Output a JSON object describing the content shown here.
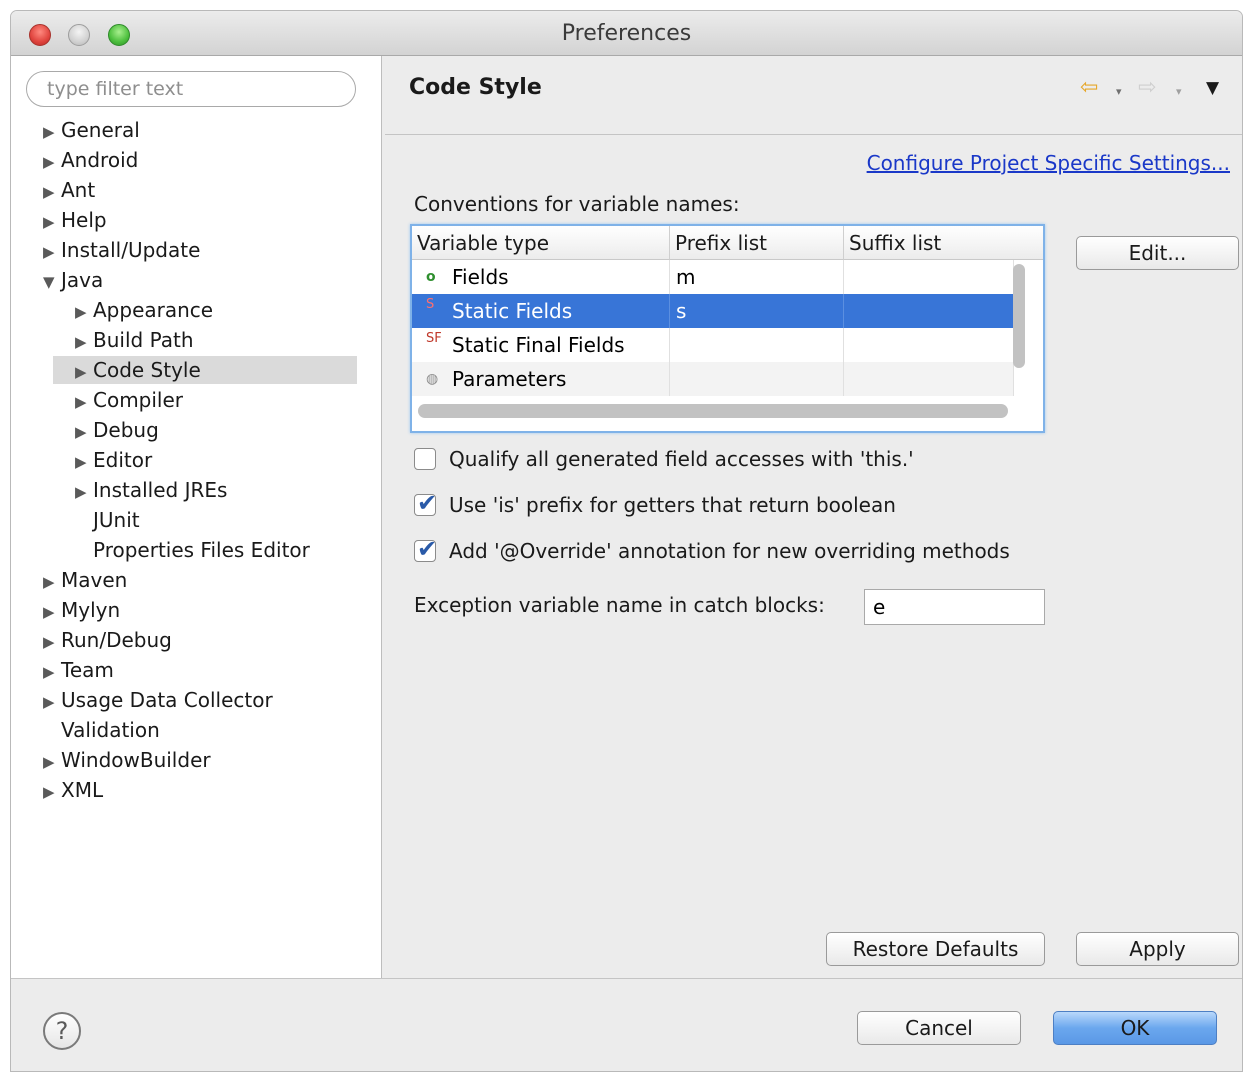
{
  "window": {
    "title": "Preferences"
  },
  "filter": {
    "placeholder": "type filter text"
  },
  "tree": [
    {
      "label": "General",
      "level": 0,
      "arrow": "▶"
    },
    {
      "label": "Android",
      "level": 0,
      "arrow": "▶"
    },
    {
      "label": "Ant",
      "level": 0,
      "arrow": "▶"
    },
    {
      "label": "Help",
      "level": 0,
      "arrow": "▶"
    },
    {
      "label": "Install/Update",
      "level": 0,
      "arrow": "▶"
    },
    {
      "label": "Java",
      "level": 0,
      "arrow": "▼"
    },
    {
      "label": "Appearance",
      "level": 1,
      "arrow": "▶"
    },
    {
      "label": "Build Path",
      "level": 1,
      "arrow": "▶"
    },
    {
      "label": "Code Style",
      "level": 1,
      "arrow": "▶",
      "selected": true
    },
    {
      "label": "Compiler",
      "level": 1,
      "arrow": "▶"
    },
    {
      "label": "Debug",
      "level": 1,
      "arrow": "▶"
    },
    {
      "label": "Editor",
      "level": 1,
      "arrow": "▶"
    },
    {
      "label": "Installed JREs",
      "level": 1,
      "arrow": "▶"
    },
    {
      "label": "JUnit",
      "level": 1,
      "arrow": ""
    },
    {
      "label": "Properties Files Editor",
      "level": 1,
      "arrow": ""
    },
    {
      "label": "Maven",
      "level": 0,
      "arrow": "▶"
    },
    {
      "label": "Mylyn",
      "level": 0,
      "arrow": "▶"
    },
    {
      "label": "Run/Debug",
      "level": 0,
      "arrow": "▶"
    },
    {
      "label": "Team",
      "level": 0,
      "arrow": "▶"
    },
    {
      "label": "Usage Data Collector",
      "level": 0,
      "arrow": "▶"
    },
    {
      "label": "Validation",
      "level": 0,
      "arrow": ""
    },
    {
      "label": "WindowBuilder",
      "level": 0,
      "arrow": "▶"
    },
    {
      "label": "XML",
      "level": 0,
      "arrow": "▶"
    }
  ],
  "page": {
    "title": "Code Style",
    "nav": {
      "back": "⇦",
      "forward": "⇨",
      "dropdown": "▾",
      "menu": "▼"
    },
    "project_link": "Configure Project Specific Settings...",
    "conventions_label": "Conventions for variable names:",
    "table": {
      "headers": [
        "Variable type",
        "Prefix list",
        "Suffix list"
      ],
      "rows": [
        {
          "icon": "field-icon",
          "glyph": "o",
          "type": "Fields",
          "prefix": "m",
          "suffix": ""
        },
        {
          "icon": "static-field-icon",
          "glyph": "S",
          "type": "Static Fields",
          "prefix": "s",
          "suffix": "",
          "selected": true
        },
        {
          "icon": "static-final-field-icon",
          "glyph": "SF",
          "type": "Static Final Fields",
          "prefix": "",
          "suffix": ""
        },
        {
          "icon": "parameter-icon",
          "glyph": "◍",
          "type": "Parameters",
          "prefix": "",
          "suffix": ""
        }
      ]
    },
    "edit_button": "Edit...",
    "checkboxes": [
      {
        "label": "Qualify all generated field accesses with 'this.'",
        "checked": false
      },
      {
        "label": "Use 'is' prefix for getters that return boolean",
        "checked": true
      },
      {
        "label": "Add '@Override' annotation for new overriding methods",
        "checked": true
      }
    ],
    "exception_label": "Exception variable name in catch blocks:",
    "exception_value": "e",
    "restore_defaults": "Restore Defaults",
    "apply": "Apply"
  },
  "footer": {
    "help": "?",
    "cancel": "Cancel",
    "ok": "OK"
  },
  "colors": {
    "selection": "#3875d7",
    "link": "#1a38c8",
    "ok_button": "#6ba7ee"
  }
}
